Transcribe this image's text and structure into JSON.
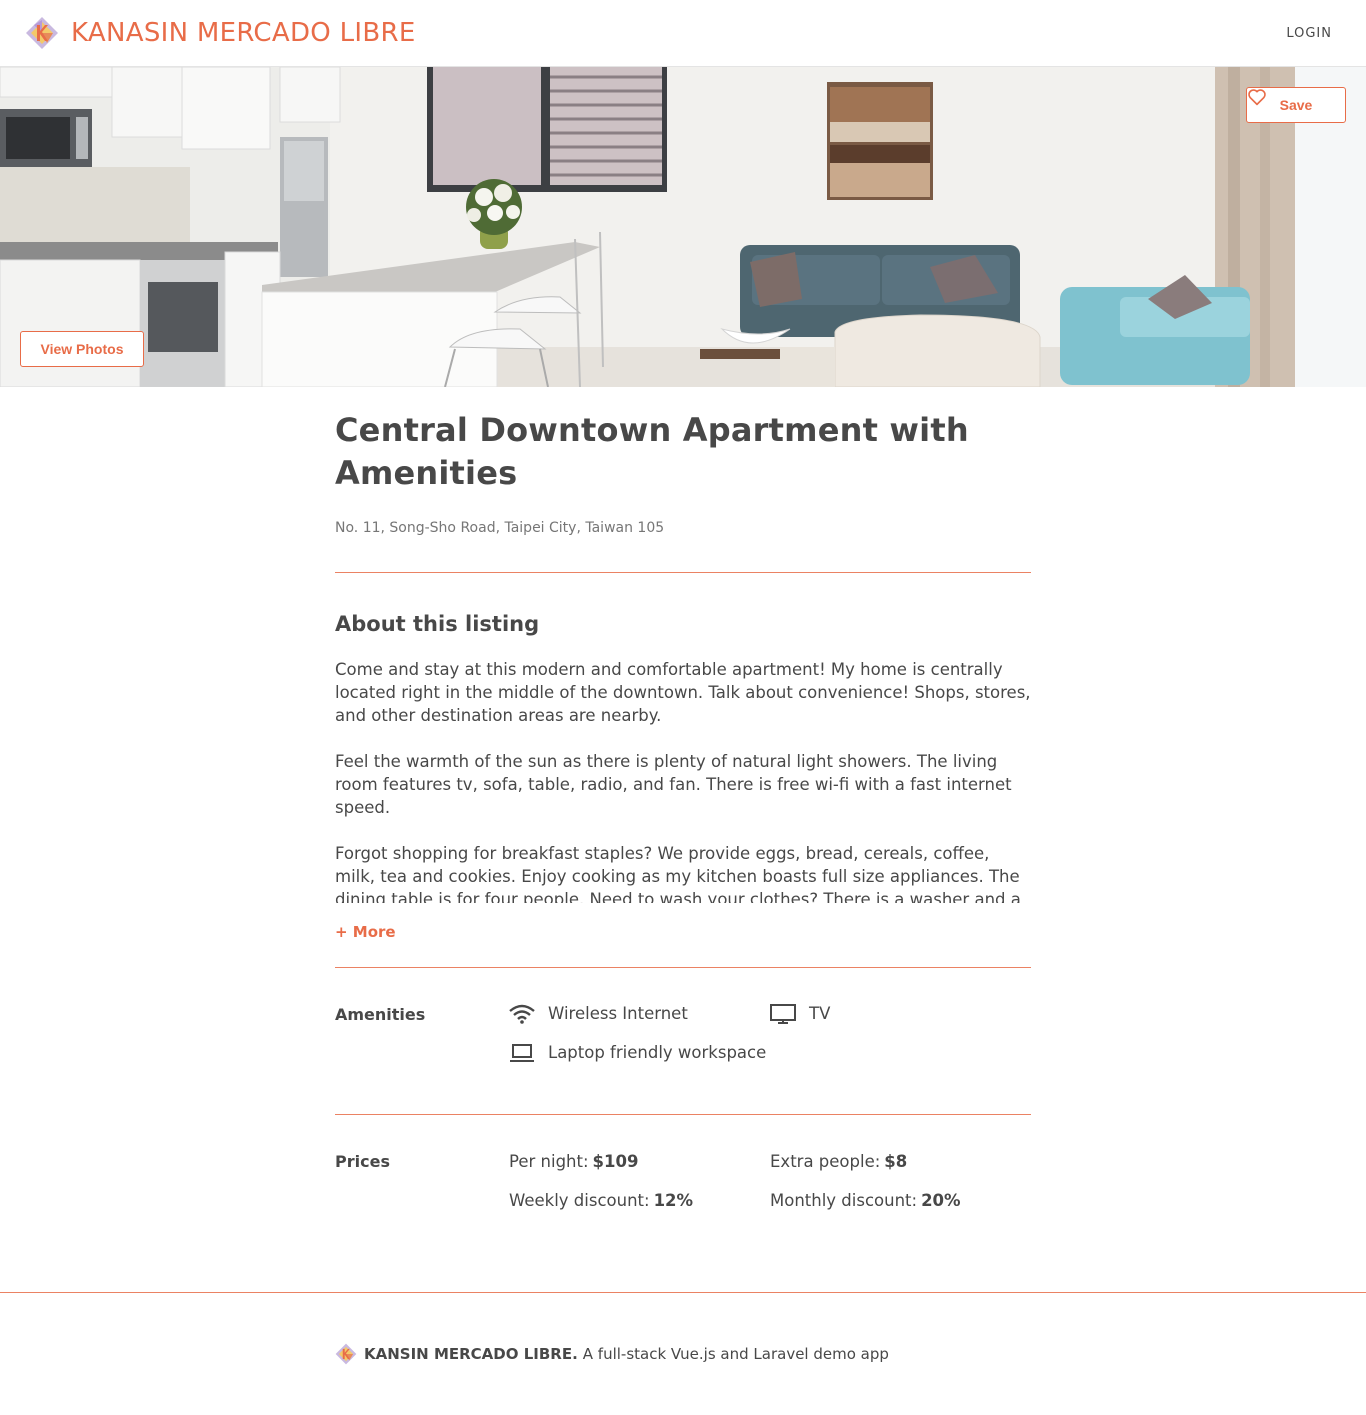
{
  "header": {
    "brand": "KANASIN MERCADO LIBRE",
    "login_label": "LOGIN"
  },
  "hero": {
    "save_label": "Save",
    "view_photos_label": "View Photos"
  },
  "listing": {
    "title": "Central Downtown Apartment with Amenities",
    "address": "No. 11, Song-Sho Road, Taipei City, Taiwan 105",
    "about_heading": "About this listing",
    "about_paragraphs": [
      "Come and stay at this modern and comfortable apartment! My home is centrally located right in the middle of the downtown. Talk about convenience! Shops, stores, and other destination areas are nearby.",
      "Feel the warmth of the sun as there is plenty of natural light showers. The living room features tv, sofa, table, radio, and fan. There is free wi-fi with a fast internet speed.",
      "Forgot shopping for breakfast staples? We provide eggs, bread, cereals, coffee, milk, tea and cookies. Enjoy cooking as my kitchen boasts full size appliances. The dining table is for four people. Need to wash your clothes? There is a washer and a dryer. We provide hampers, detergents, and clothing conditioner."
    ],
    "more_label": "+ More"
  },
  "amenities": {
    "label": "Amenities",
    "items": [
      {
        "icon": "wifi-icon",
        "label": "Wireless Internet"
      },
      {
        "icon": "tv-icon",
        "label": "TV"
      },
      {
        "icon": "laptop-icon",
        "label": "Laptop friendly workspace"
      }
    ]
  },
  "prices": {
    "label": "Prices",
    "items": [
      {
        "label": "Per night:",
        "value": "$109"
      },
      {
        "label": "Extra people:",
        "value": "$8"
      },
      {
        "label": "Weekly discount:",
        "value": "12%"
      },
      {
        "label": "Monthly discount:",
        "value": "20%"
      }
    ]
  },
  "footer": {
    "brand": "KANSIN MERCADO LIBRE.",
    "tagline": "A full-stack Vue.js and Laravel demo app"
  },
  "colors": {
    "accent": "#e86c48",
    "text": "#484848",
    "muted": "#767676"
  }
}
